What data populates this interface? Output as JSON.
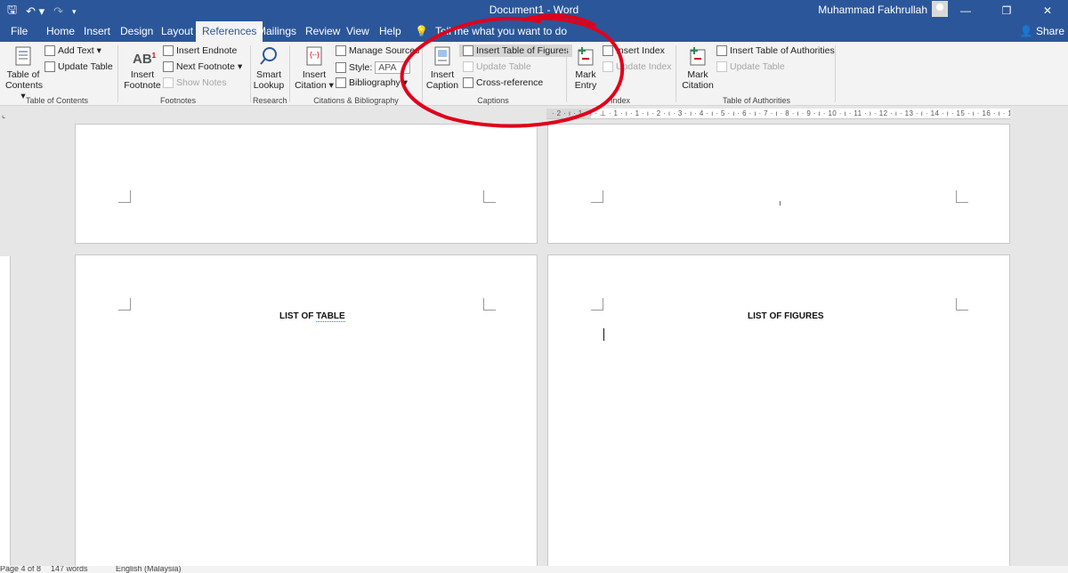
{
  "window": {
    "title": "Document1  -  Word",
    "user": "Muhammad Fakhrullah"
  },
  "qat": {
    "save": "save-icon",
    "undo": "undo-icon",
    "redo": "redo-icon"
  },
  "tabs": [
    "File",
    "Home",
    "Insert",
    "Design",
    "Layout",
    "References",
    "Mailings",
    "Review",
    "View",
    "Help"
  ],
  "tell_me": "Tell me what you want to do",
  "share": "Share",
  "ribbon": {
    "toc": {
      "btn": "Table of Contents",
      "add_text": "Add Text",
      "update_table": "Update Table",
      "label": "Table of Contents"
    },
    "footnotes": {
      "insert_footnote": "Insert Footnote",
      "insert_endnote": "Insert Endnote",
      "next_footnote": "Next Footnote",
      "show_notes": "Show Notes",
      "label": "Footnotes",
      "ab_mark": "AB"
    },
    "research": {
      "smart_lookup": "Smart Lookup",
      "label": "Research"
    },
    "citations": {
      "insert_citation": "Insert Citation",
      "manage_sources": "Manage Sources",
      "style_label": "Style:",
      "style_value": "APA",
      "bibliography": "Bibliography",
      "label": "Citations & Bibliography"
    },
    "captions": {
      "insert_caption": "Insert Caption",
      "insert_tof": "Insert Table of Figures",
      "update_table": "Update Table",
      "cross_ref": "Cross-reference",
      "label": "Captions"
    },
    "index": {
      "mark_entry": "Mark Entry",
      "insert_index": "Insert Index",
      "update_index": "Update Index",
      "label": "Index"
    },
    "toa": {
      "mark_citation": "Mark Citation",
      "insert_toa": "Insert Table of Authorities",
      "update_table": "Update Table",
      "label": "Table of Authorities"
    }
  },
  "ruler": {
    "marks": "· 2 · ı · 1 · ı · ⊥ · 1 · ı · 1 · ı · 2 · ı · 3 · ı · 4 · ı · 5 · ı · 6 · ı · 7 · ı · 8 · ı · 9 · ı · 10 · ı · 11 · ı · 12 · ı · 13 · ı · 14 · ı · 15 · ı · 16 · ı · 17 · ı · 18 ·"
  },
  "pages": {
    "left_heading": "LIST OF TABLE",
    "left_heading_a": "LIST OF ",
    "left_heading_b": "TABLE",
    "right_heading": "LIST OF FIGURES"
  },
  "status": {
    "page": "Page 4 of 8",
    "words": "147 words",
    "language": "English (Malaysia)"
  },
  "colors": {
    "accent": "#2b579a",
    "annotation": "#e0001b"
  }
}
